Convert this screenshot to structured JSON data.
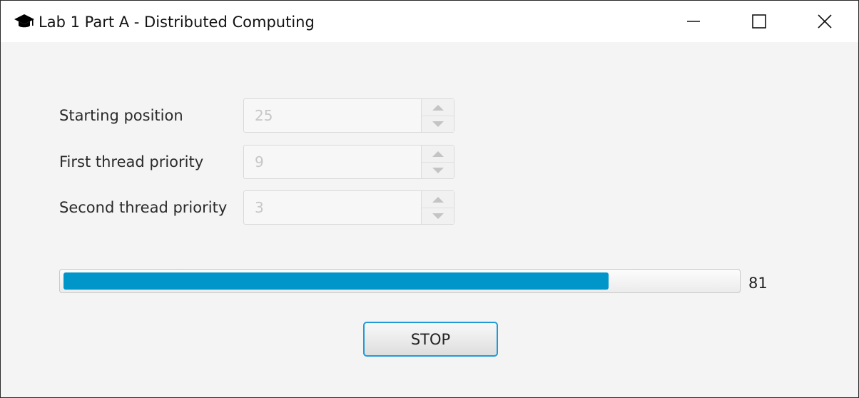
{
  "window": {
    "title": "Lab 1 Part A - Distributed Computing",
    "icon": "graduation-cap-icon",
    "controls": [
      "minimize-icon",
      "maximize-icon",
      "close-icon"
    ]
  },
  "form": {
    "starting_position": {
      "label": "Starting position",
      "value": "25"
    },
    "first_thread_priority": {
      "label": "First thread priority",
      "value": "9"
    },
    "second_thread_priority": {
      "label": "Second thread priority",
      "value": "3"
    }
  },
  "progress": {
    "value": "81",
    "fraction": 0.81,
    "fill_color": "#0096c9"
  },
  "actions": {
    "stop_label": "STOP",
    "accent_color": "#1f9ad8"
  }
}
